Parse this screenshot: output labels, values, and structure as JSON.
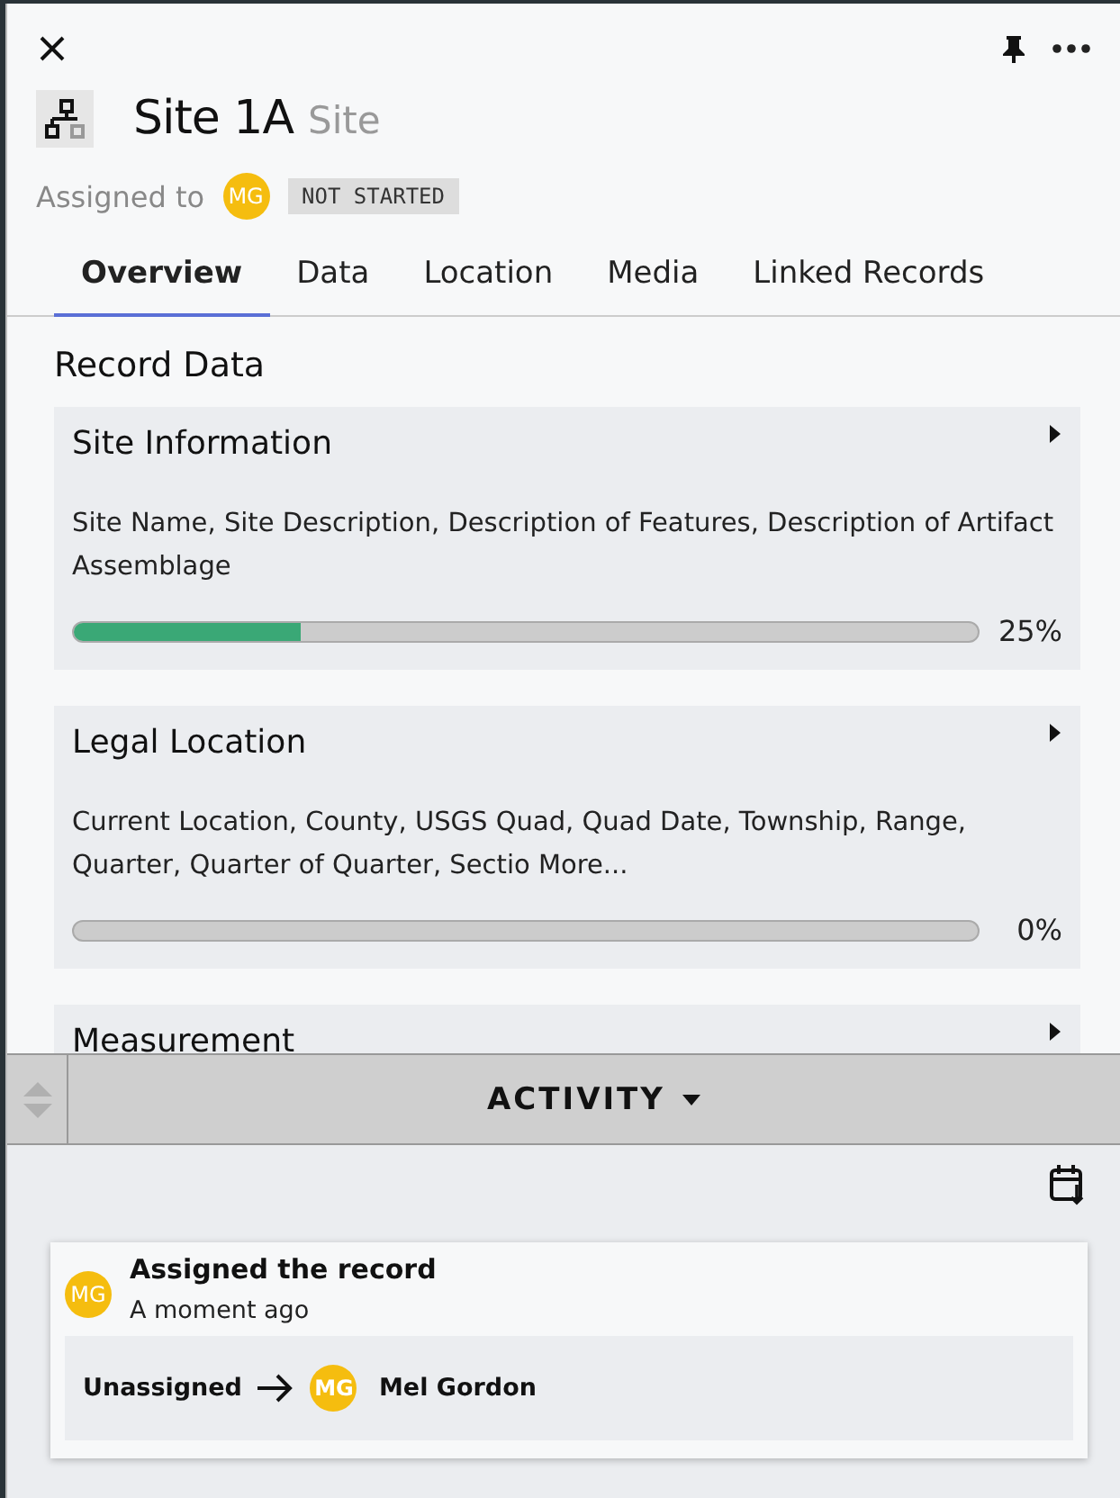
{
  "header": {
    "title": "Site 1A",
    "type": "Site",
    "assigned_label": "Assigned to",
    "assignee_initials": "MG",
    "status": "NOT STARTED"
  },
  "tabs": [
    {
      "label": "Overview",
      "selected": true
    },
    {
      "label": "Data",
      "selected": false
    },
    {
      "label": "Location",
      "selected": false
    },
    {
      "label": "Media",
      "selected": false
    },
    {
      "label": "Linked Records",
      "selected": false
    }
  ],
  "record_data": {
    "heading": "Record Data",
    "sections": [
      {
        "title": "Site Information",
        "fields": "Site Name, Site Description, Description of Features, Description of Artifact Assemblage",
        "level": 0.25,
        "percent": "25%"
      },
      {
        "title": "Legal Location",
        "fields": "Current Location, County, USGS Quad, Quad Date, Township, Range, Quarter, Quarter of Quarter, Sectio ",
        "more": "More...",
        "level": 0,
        "percent": "0%"
      },
      {
        "title": "Measurement"
      }
    ]
  },
  "activity": {
    "title": "ACTIVITY",
    "entries": [
      {
        "initials": "MG",
        "action": "Assigned the record",
        "time": "A moment ago",
        "from": "Unassigned",
        "to_initials": "MG",
        "to": "Mel Gordon"
      }
    ]
  }
}
